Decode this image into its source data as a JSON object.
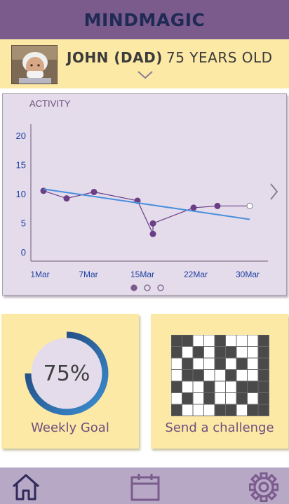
{
  "app": {
    "title": "MINDMAGIC"
  },
  "profile": {
    "name": "JOHN (DAD)",
    "age": "75 YEARS OLD"
  },
  "chart": {
    "title": "ACTIVITY",
    "pager": {
      "pages": 3,
      "active": 1
    }
  },
  "chart_data": {
    "type": "line",
    "title": "ACTIVITY",
    "x": [
      "1Mar",
      "4Mar",
      "7Mar",
      "12Mar",
      "15Mar",
      "16Mar",
      "21Mar",
      "24Mar",
      "30Mar"
    ],
    "x_tick_labels": [
      "1Mar",
      "7Mar",
      "15Mar",
      "22Mar",
      "30Mar"
    ],
    "y_tick_labels": [
      "0",
      "5",
      "10",
      "15",
      "20"
    ],
    "ylim": [
      0,
      20
    ],
    "series": [
      {
        "values": [
          10.5,
          9.2,
          10.3,
          8.8,
          3.1,
          4.9,
          7.6,
          7.9
        ]
      },
      {
        "values": [
          10.8,
          5.6
        ],
        "trendline": true
      }
    ],
    "trend_x": [
      "1Mar",
      "30Mar"
    ],
    "colors": {
      "line": "#6a3f86",
      "trend": "#4a8fdc",
      "axis": "#1f3fa0"
    }
  },
  "tiles": {
    "goal": {
      "percent": "75%",
      "label": "Weekly Goal",
      "value": 0.75
    },
    "challenge": {
      "label": "Send a challenge"
    }
  },
  "nav": {
    "items": [
      {
        "icon": "home-icon"
      },
      {
        "icon": "calendar-icon"
      },
      {
        "icon": "gear-icon"
      }
    ]
  }
}
